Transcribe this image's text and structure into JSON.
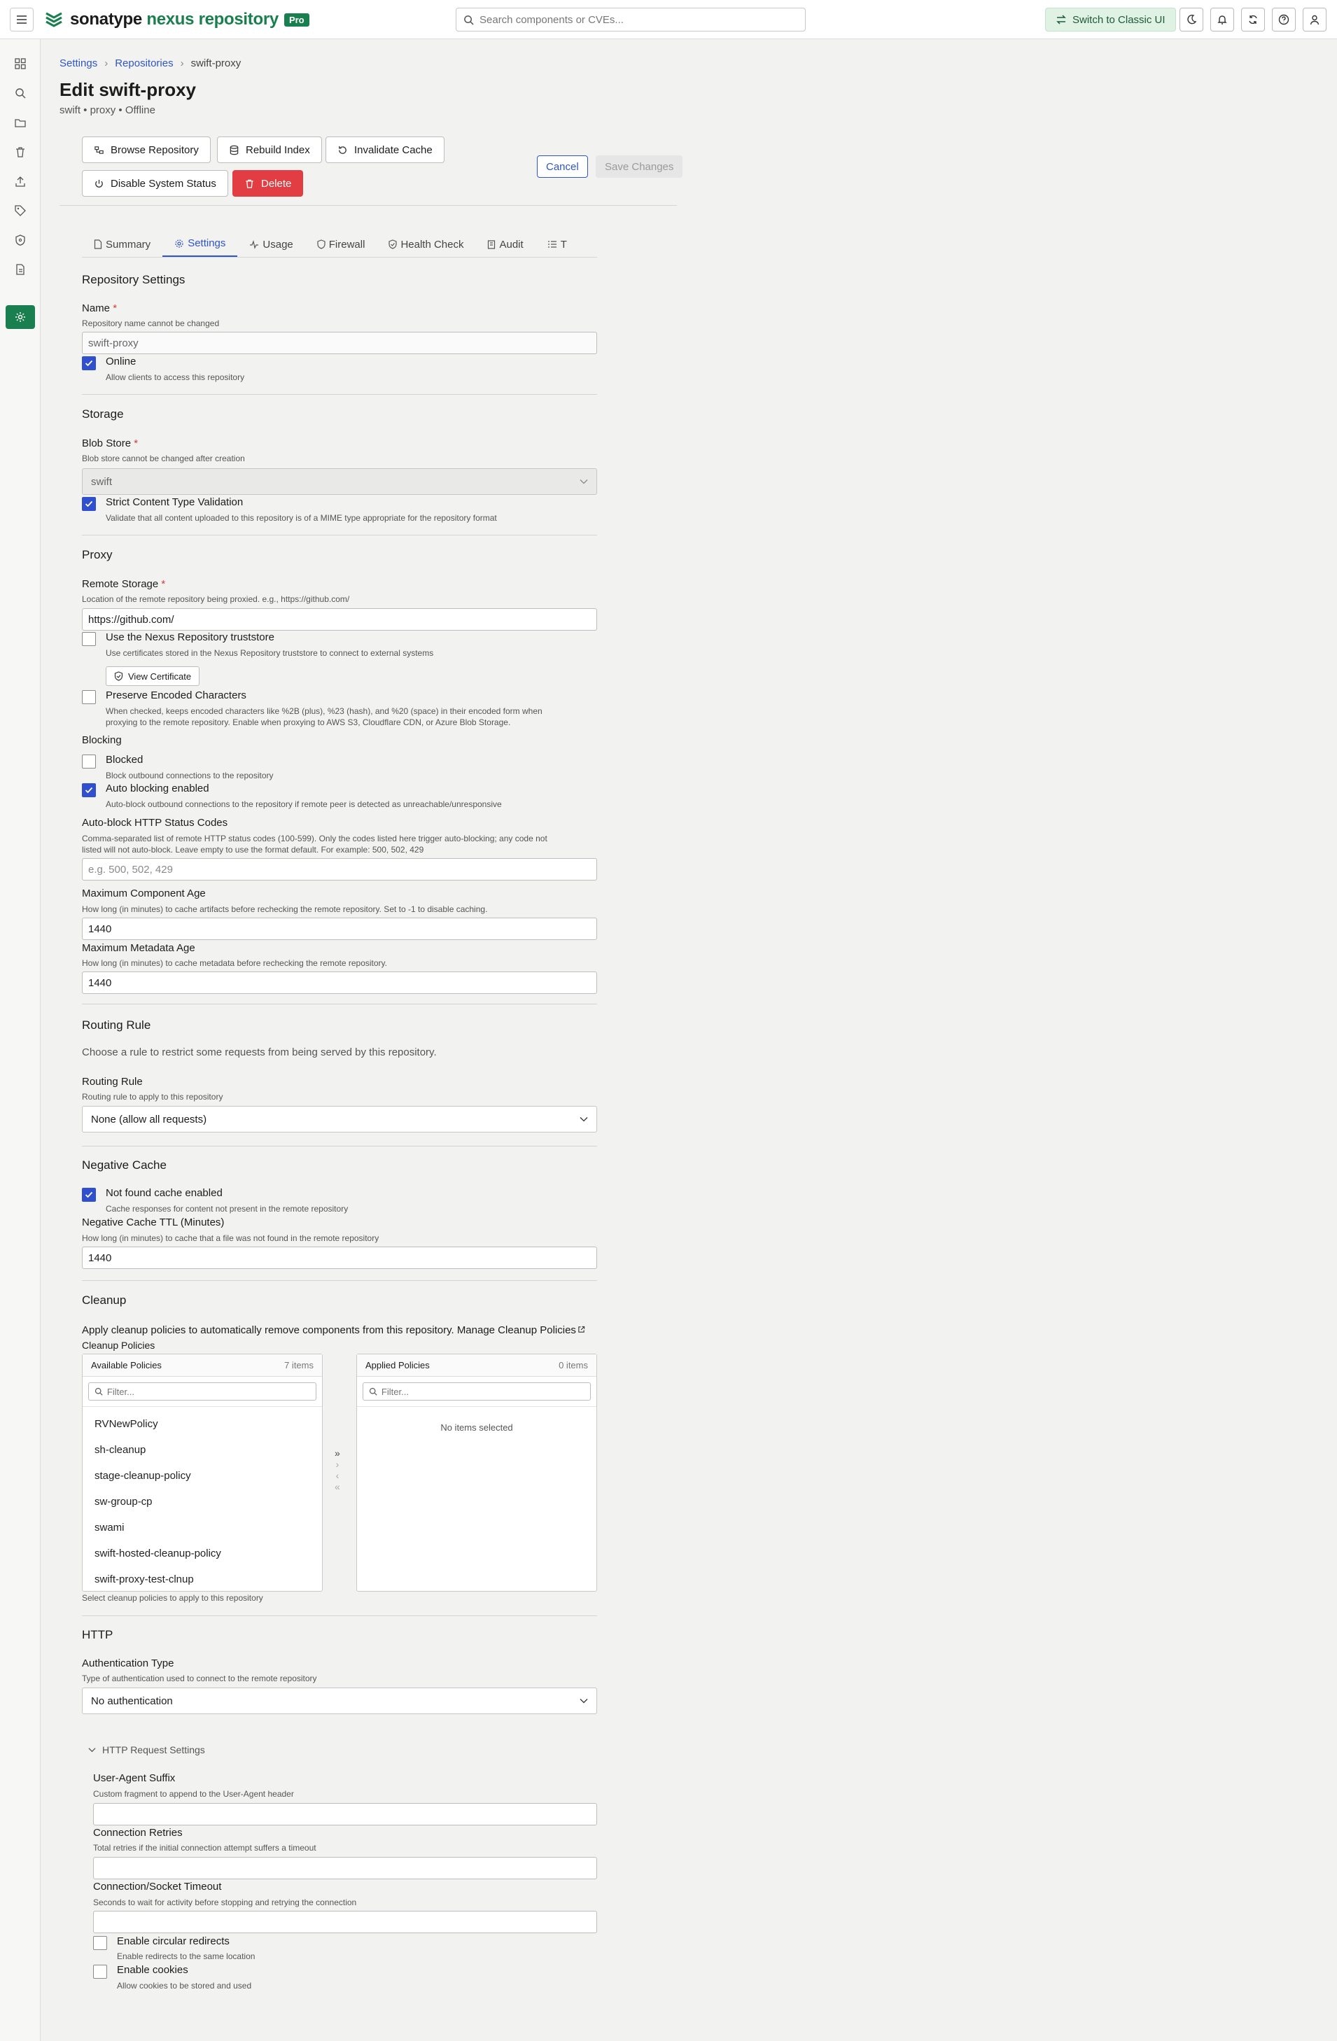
{
  "header": {
    "brand_sonatype": "sonatype",
    "brand_nexus": "nexus repository",
    "pro_badge": "Pro",
    "search_placeholder": "Search components or CVEs...",
    "classic_button": "Switch to Classic UI"
  },
  "breadcrumb": {
    "settings": "Settings",
    "repositories": "Repositories",
    "current": "swift-proxy"
  },
  "page": {
    "title": "Edit swift-proxy",
    "subtitle": "swift • proxy • Offline"
  },
  "actions": {
    "browse": "Browse Repository",
    "rebuild": "Rebuild Index",
    "invalidate": "Invalidate Cache",
    "disable": "Disable System Status",
    "delete": "Delete",
    "cancel": "Cancel",
    "save": "Save Changes"
  },
  "tabs": [
    "Summary",
    "Settings",
    "Usage",
    "Firewall",
    "Health Check",
    "Audit",
    "T"
  ],
  "repository_settings": {
    "heading": "Repository Settings",
    "name_label": "Name",
    "name_hint": "Repository name cannot be changed",
    "name_value": "swift-proxy",
    "online_label": "Online",
    "online_hint": "Allow clients to access this repository"
  },
  "storage": {
    "heading": "Storage",
    "blob_label": "Blob Store",
    "blob_hint": "Blob store cannot be changed after creation",
    "blob_value": "swift",
    "strict_label": "Strict Content Type Validation",
    "strict_hint": "Validate that all content uploaded to this repository is of a MIME type appropriate for the repository format"
  },
  "proxy": {
    "heading": "Proxy",
    "remote_label": "Remote Storage",
    "remote_hint": "Location of the remote repository being proxied. e.g., https://github.com/",
    "remote_value": "https://github.com/",
    "truststore_label": "Use the Nexus Repository truststore",
    "truststore_hint": "Use certificates stored in the Nexus Repository truststore to connect to external systems",
    "view_cert": "View Certificate",
    "preserve_label": "Preserve Encoded Characters",
    "preserve_hint1": "When checked, keeps encoded characters like %2B (plus), %23 (hash), and %20 (space) in their encoded form when",
    "preserve_hint2": "proxying to the remote repository. Enable when proxying to AWS S3, Cloudflare CDN, or Azure Blob Storage.",
    "blocking_heading": "Blocking",
    "blocked_label": "Blocked",
    "blocked_hint": "Block outbound connections to the repository",
    "auto_label": "Auto blocking enabled",
    "auto_hint": "Auto-block outbound connections to the repository if remote peer is detected as unreachable/unresponsive",
    "status_label": "Auto-block HTTP Status Codes",
    "status_hint1": "Comma-separated list of remote HTTP status codes (100-599). Only the codes listed here trigger auto-blocking; any code not",
    "status_hint2": "listed will not auto-block. Leave empty to use the format default. For example: 500, 502, 429",
    "status_placeholder": "e.g. 500, 502, 429",
    "max_comp_label": "Maximum Component Age",
    "max_comp_hint": "How long (in minutes) to cache artifacts before rechecking the remote repository. Set to -1 to disable caching.",
    "max_comp_value": "1440",
    "max_meta_label": "Maximum Metadata Age",
    "max_meta_hint": "How long (in minutes) to cache metadata before rechecking the remote repository.",
    "max_meta_value": "1440"
  },
  "routing": {
    "heading": "Routing Rule",
    "desc": "Choose a rule to restrict some requests from being served by this repository.",
    "label": "Routing Rule",
    "hint": "Routing rule to apply to this repository",
    "value": "None (allow all requests)"
  },
  "negative_cache": {
    "heading": "Negative Cache",
    "enabled_label": "Not found cache enabled",
    "enabled_hint": "Cache responses for content not present in the remote repository",
    "ttl_label": "Negative Cache TTL (Minutes)",
    "ttl_hint": "How long (in minutes) to cache that a file was not found in the remote repository",
    "ttl_value": "1440"
  },
  "cleanup": {
    "heading": "Cleanup",
    "desc": "Apply cleanup policies to automatically remove components from this repository.",
    "manage_link": "Manage Cleanup Policies",
    "policies_label": "Cleanup Policies",
    "available_title": "Available Policies",
    "available_count": "7 items",
    "applied_title": "Applied Policies",
    "applied_count": "0 items",
    "filter_placeholder": "Filter...",
    "available": [
      "RVNewPolicy",
      "sh-cleanup",
      "stage-cleanup-policy",
      "sw-group-cp",
      "swami",
      "swift-hosted-cleanup-policy",
      "swift-proxy-test-clnup"
    ],
    "empty": "No items selected",
    "hint": "Select cleanup policies to apply to this repository"
  },
  "http": {
    "heading": "HTTP",
    "auth_label": "Authentication Type",
    "auth_hint": "Type of authentication used to connect to the remote repository",
    "auth_value": "No authentication",
    "request_settings": "HTTP Request Settings",
    "ua_label": "User-Agent Suffix",
    "ua_hint": "Custom fragment to append to the User-Agent header",
    "retries_label": "Connection Retries",
    "retries_hint": "Total retries if the initial connection attempt suffers a timeout",
    "timeout_label": "Connection/Socket Timeout",
    "timeout_hint": "Seconds to wait for activity before stopping and retrying the connection",
    "circular_label": "Enable circular redirects",
    "circular_hint": "Enable redirects to the same location",
    "cookies_label": "Enable cookies",
    "cookies_hint": "Allow cookies to be stored and used"
  }
}
